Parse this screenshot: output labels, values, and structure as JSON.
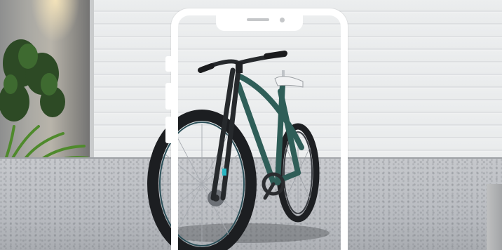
{
  "scene": {
    "subject": "bicycle-icon",
    "frame": "phone-frame-icon",
    "colors": {
      "bike_frame": "#2f5e58",
      "wall": "#eceeef",
      "ground": "#bcbfc4",
      "phone_frame": "#ffffff",
      "accent_cyan": "#29b7c4"
    }
  }
}
